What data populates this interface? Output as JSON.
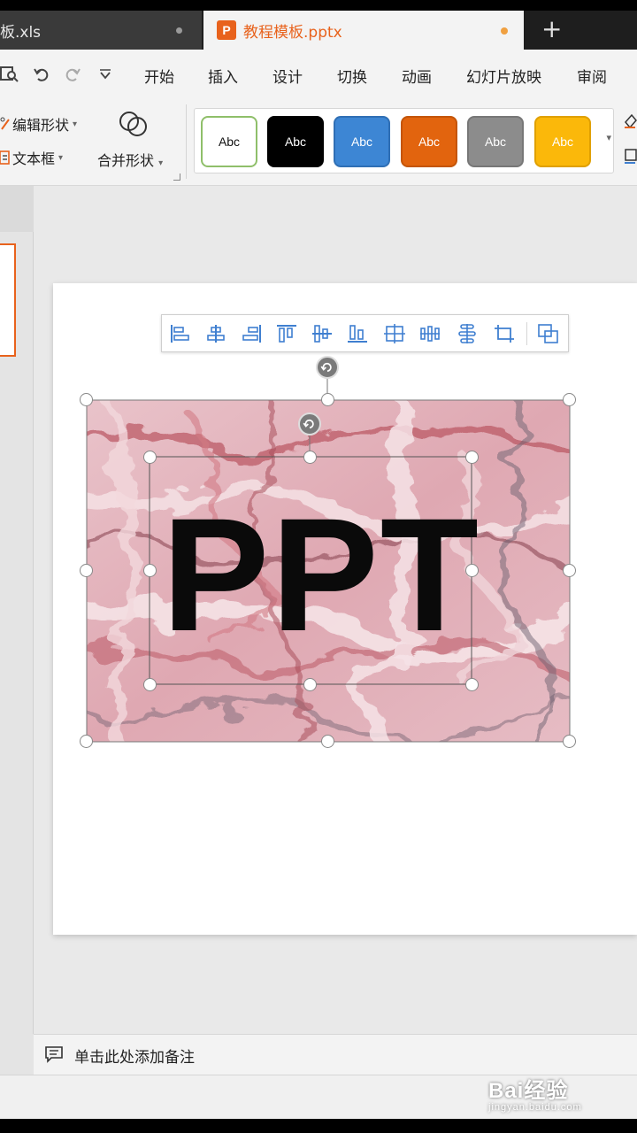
{
  "tabs": {
    "xls_label": "板.xls",
    "pptx_label": "教程模板.pptx",
    "pptx_icon_letter": "P",
    "new_tab": "+"
  },
  "menu": {
    "items": [
      "开始",
      "插入",
      "设计",
      "切换",
      "动画",
      "幻灯片放映",
      "审阅"
    ]
  },
  "ribbon": {
    "edit_shape": "编辑形状",
    "text_box": "文本框",
    "merge_shape": "合并形状",
    "styles": [
      {
        "label": "Abc",
        "bg": "#ffffff",
        "fg": "#111111",
        "border": "#8fbf6a"
      },
      {
        "label": "Abc",
        "bg": "#000000",
        "fg": "#ffffff",
        "border": "#000000"
      },
      {
        "label": "Abc",
        "bg": "#3d86d4",
        "fg": "#ffffff",
        "border": "#2f6fb5"
      },
      {
        "label": "Abc",
        "bg": "#e2640e",
        "fg": "#ffffff",
        "border": "#c45508"
      },
      {
        "label": "Abc",
        "bg": "#8c8c8c",
        "fg": "#ffffff",
        "border": "#777777"
      },
      {
        "label": "Abc",
        "bg": "#fbb80a",
        "fg": "#ffffff",
        "border": "#e0a000"
      }
    ]
  },
  "slide": {
    "big_text": "PPT"
  },
  "notes": {
    "placeholder": "单击此处添加备注"
  },
  "watermark": {
    "brand": "Bai经验",
    "url": "jingyan.baidu.com"
  },
  "colors": {
    "accent": "#e8621c",
    "align_icon": "#3f7fd0"
  }
}
